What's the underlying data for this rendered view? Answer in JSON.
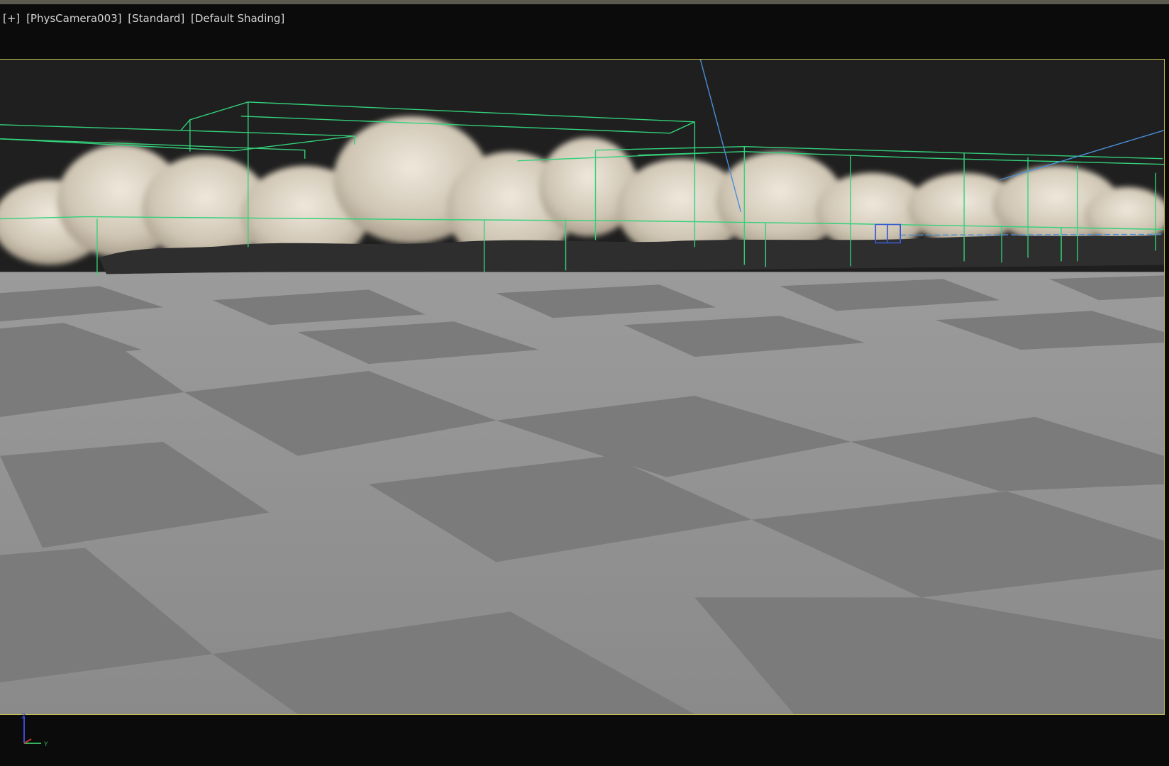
{
  "viewport": {
    "label_parts": [
      "[+]",
      "[PhysCamera003]",
      "[Standard]",
      "[Default Shading]"
    ],
    "safe_frame_color": "#c9c24a",
    "background_color": "#1f1f1f",
    "floor": {
      "light_tile_color": "#b8b8b8",
      "dark_tile_color": "#7b7b7b"
    },
    "gizmo_color": "#34d17a",
    "camera_line_color": "#4a8fd9",
    "smoke_color": "#d9d0c0",
    "axis_tripod": {
      "icon": "axis-tripod-icon",
      "x_label": "",
      "y_label": "Y",
      "z_label": "Z"
    }
  }
}
